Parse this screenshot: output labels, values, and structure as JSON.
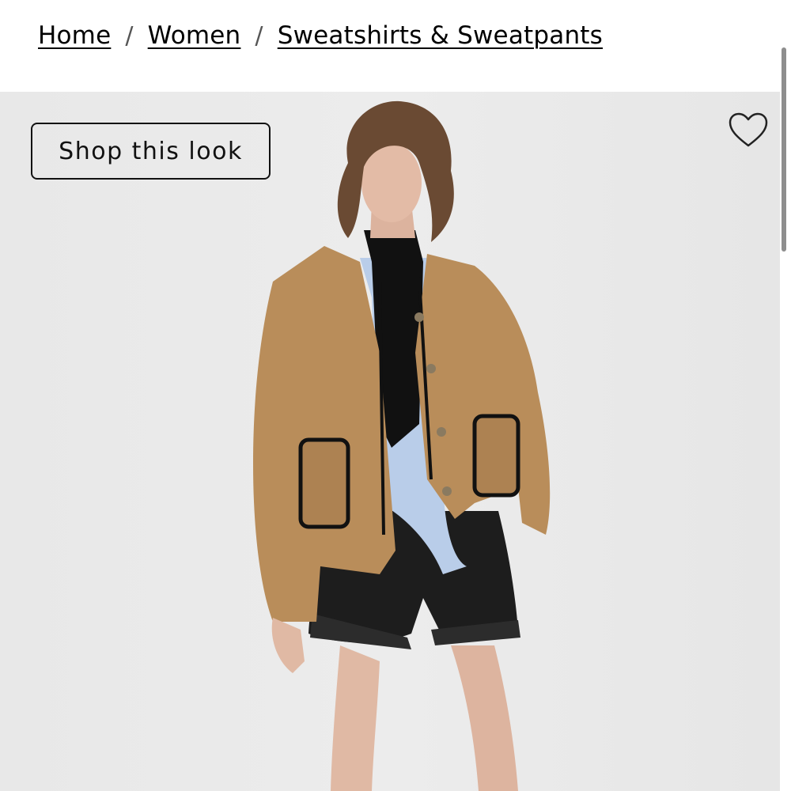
{
  "breadcrumb": {
    "items": [
      {
        "label": "Home"
      },
      {
        "label": "Women"
      },
      {
        "label": "Sweatshirts & Sweatpants"
      }
    ],
    "separator": "/"
  },
  "hero": {
    "shop_this_look_label": "Shop this look",
    "wishlist_icon": "heart-outline-icon",
    "image_alt": "Model wearing a camel sherpa jacket with black trim, black turtleneck, light blue shirt and black leather shorts"
  },
  "colors": {
    "background": "#ffffff",
    "hero_background": "#eaeaea",
    "text": "#000000",
    "jacket": "#b98d5a"
  }
}
